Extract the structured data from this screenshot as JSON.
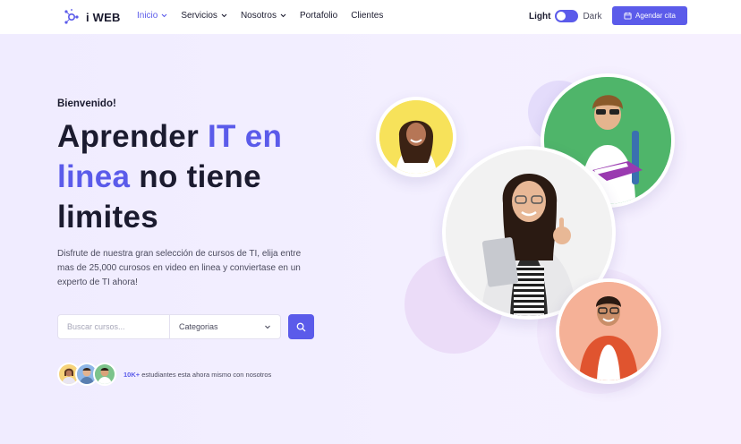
{
  "brand": {
    "name": "i WEB"
  },
  "nav": {
    "items": [
      {
        "label": "Inicio",
        "has_dropdown": true,
        "active": true
      },
      {
        "label": "Servicios",
        "has_dropdown": true,
        "active": false
      },
      {
        "label": "Nosotros",
        "has_dropdown": true,
        "active": false
      },
      {
        "label": "Portafolio",
        "has_dropdown": false,
        "active": false
      },
      {
        "label": "Clientes",
        "has_dropdown": false,
        "active": false
      }
    ]
  },
  "theme_toggle": {
    "light_label": "Light",
    "dark_label": "Dark",
    "selected": "light"
  },
  "cta": {
    "label": "Agendar cita",
    "icon": "calendar-icon"
  },
  "hero": {
    "welcome": "Bienvenido!",
    "headline": {
      "part1": "Aprender ",
      "accent1": "IT en",
      "accent2": "linea",
      "part2": " no tiene",
      "part3": "limites"
    },
    "description": "Disfrute de nuestra gran selección de cursos de TI, elija entre mas de 25,000 curosos en video en linea y conviertase en un experto de TI ahora!",
    "search": {
      "placeholder": "Buscar cursos...",
      "category_value": "Categorias"
    },
    "students": {
      "count": "10K+",
      "text": " estudiantes esta ahora mismo con nosotros"
    }
  },
  "colors": {
    "accent": "#5b5bea",
    "text": "#1b1b2f",
    "background": "#f3efff"
  }
}
